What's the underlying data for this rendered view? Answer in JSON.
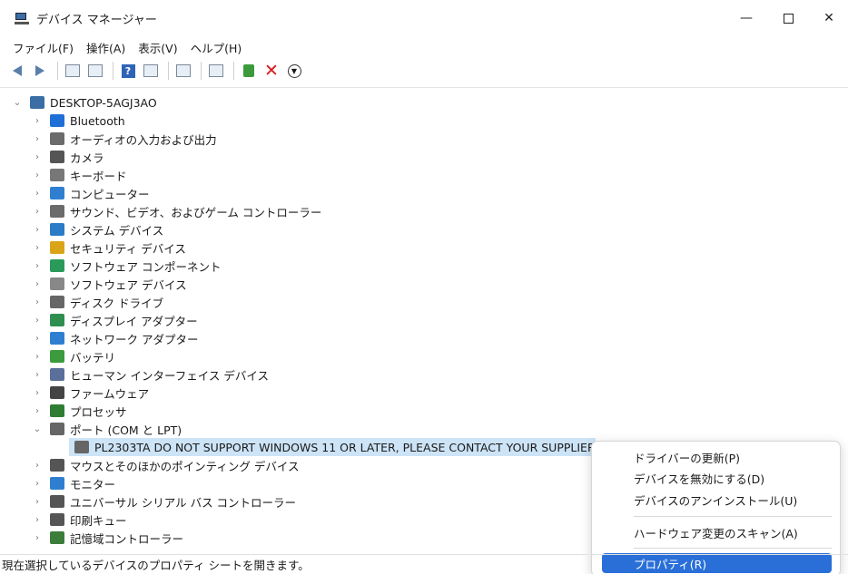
{
  "window": {
    "title": "デバイス マネージャー",
    "minimize_glyph": "—",
    "close_glyph": "✕"
  },
  "menu": [
    "ファイル(F)",
    "操作(A)",
    "表示(V)",
    "ヘルプ(H)"
  ],
  "toolbar": {
    "help_glyph": "?",
    "delete_glyph": "✕",
    "download_glyph": "▼"
  },
  "tree": {
    "root": "DESKTOP-5AGJ3AO",
    "root_chevron": "⌄",
    "collapsed_chevron": "›",
    "expanded_chevron": "⌄",
    "categories": [
      {
        "label": "Bluetooth",
        "icon": "bluetooth-icon",
        "color": "#1f6fd6"
      },
      {
        "label": "オーディオの入力および出力",
        "icon": "speaker-icon",
        "color": "#6b6b6b"
      },
      {
        "label": "カメラ",
        "icon": "camera-icon",
        "color": "#555555"
      },
      {
        "label": "キーボード",
        "icon": "keyboard-icon",
        "color": "#777777"
      },
      {
        "label": "コンピューター",
        "icon": "computer-icon",
        "color": "#2f7fd0"
      },
      {
        "label": "サウンド、ビデオ、およびゲーム コントローラー",
        "icon": "speaker-icon",
        "color": "#6b6b6b"
      },
      {
        "label": "システム デバイス",
        "icon": "system-folder-icon",
        "color": "#2a7cc7"
      },
      {
        "label": "セキュリティ デバイス",
        "icon": "security-key-icon",
        "color": "#d9a418"
      },
      {
        "label": "ソフトウェア コンポーネント",
        "icon": "component-icon",
        "color": "#2a9a5a"
      },
      {
        "label": "ソフトウェア デバイス",
        "icon": "software-device-icon",
        "color": "#888888"
      },
      {
        "label": "ディスク ドライブ",
        "icon": "disk-drive-icon",
        "color": "#666666"
      },
      {
        "label": "ディスプレイ アダプター",
        "icon": "display-adapter-icon",
        "color": "#2f8f4f"
      },
      {
        "label": "ネットワーク アダプター",
        "icon": "network-adapter-icon",
        "color": "#2f7fd0"
      },
      {
        "label": "バッテリ",
        "icon": "battery-icon",
        "color": "#3c9b3c"
      },
      {
        "label": "ヒューマン インターフェイス デバイス",
        "icon": "hid-icon",
        "color": "#5a6f9a"
      },
      {
        "label": "ファームウェア",
        "icon": "firmware-icon",
        "color": "#444444"
      },
      {
        "label": "プロセッサ",
        "icon": "processor-icon",
        "color": "#2e7d32"
      },
      {
        "label": "ポート (COM と LPT)",
        "icon": "port-icon",
        "color": "#666666",
        "expanded": true
      },
      {
        "label": "マウスとそのほかのポインティング デバイス",
        "icon": "mouse-icon",
        "color": "#555555"
      },
      {
        "label": "モニター",
        "icon": "monitor-icon",
        "color": "#2f7fd0"
      },
      {
        "label": "ユニバーサル シリアル バス コントローラー",
        "icon": "usb-icon",
        "color": "#555555"
      },
      {
        "label": "印刷キュー",
        "icon": "printer-icon",
        "color": "#555555"
      },
      {
        "label": "記憶域コントローラー",
        "icon": "storage-controller-icon",
        "color": "#3c7d3c"
      }
    ],
    "selected_child": "PL2303TA DO NOT SUPPORT WINDOWS 11 OR LATER, PLEASE CONTACT YOUR SUPPLIER"
  },
  "context_menu": {
    "items": [
      "ドライバーの更新(P)",
      "デバイスを無効にする(D)",
      "デバイスのアンインストール(U)",
      "ハードウェア変更のスキャン(A)",
      "プロパティ(R)"
    ],
    "highlighted": "プロパティ(R)"
  },
  "status_bar": "現在選択しているデバイスのプロパティ シートを開きます。",
  "colors": {
    "selection": "#cde4f7",
    "menu_highlight": "#2a6fd8"
  }
}
